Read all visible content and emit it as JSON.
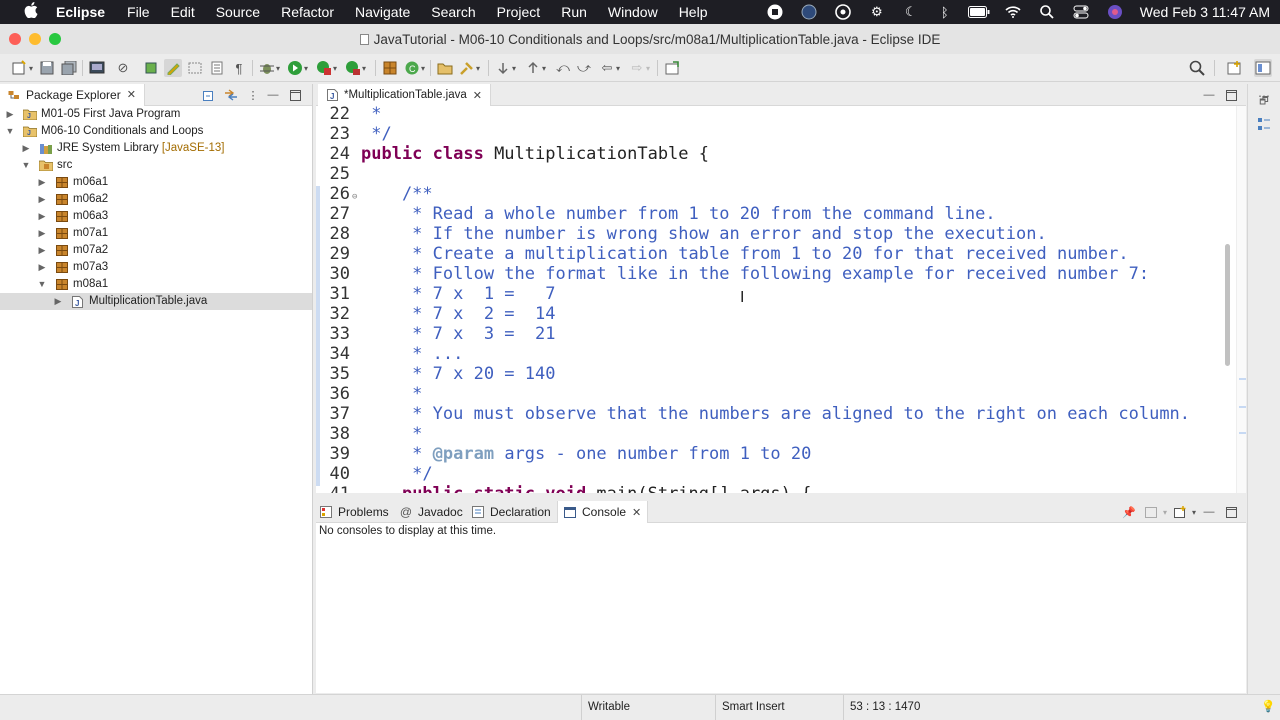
{
  "menubar": {
    "app": "Eclipse",
    "items": [
      "File",
      "Edit",
      "Source",
      "Refactor",
      "Navigate",
      "Search",
      "Project",
      "Run",
      "Window",
      "Help"
    ],
    "clock": "Wed Feb 3  11:47 AM"
  },
  "window": {
    "title": "JavaTutorial - M06-10 Conditionals and Loops/src/m08a1/MultiplicationTable.java - Eclipse IDE"
  },
  "package_explorer": {
    "tab_label": "Package Explorer",
    "tree": [
      {
        "label": "M01-05 First Java Program",
        "decoration": "",
        "expanded": false
      },
      {
        "label": "M06-10 Conditionals and Loops",
        "decoration": "",
        "expanded": true
      },
      {
        "label": "JRE System Library",
        "decoration": "[JavaSE-13]",
        "expanded": false
      },
      {
        "label": "src",
        "decoration": "",
        "expanded": true
      },
      {
        "label": "m06a1",
        "decoration": "",
        "expanded": false
      },
      {
        "label": "m06a2",
        "decoration": "",
        "expanded": false
      },
      {
        "label": "m06a3",
        "decoration": "",
        "expanded": false
      },
      {
        "label": "m07a1",
        "decoration": "",
        "expanded": false
      },
      {
        "label": "m07a2",
        "decoration": "",
        "expanded": false
      },
      {
        "label": "m07a3",
        "decoration": "",
        "expanded": false
      },
      {
        "label": "m08a1",
        "decoration": "",
        "expanded": true
      },
      {
        "label": "MultiplicationTable.java",
        "decoration": "",
        "expanded": false
      }
    ]
  },
  "editor": {
    "tab_label": "*MultiplicationTable.java",
    "lines": [
      {
        "n": "22",
        "kind": "jd",
        "text": " *"
      },
      {
        "n": "23",
        "kind": "jd",
        "text": " */"
      },
      {
        "n": "24",
        "kind": "decl",
        "kw": "public class",
        "text": " MultiplicationTable {"
      },
      {
        "n": "25",
        "kind": "plain",
        "text": ""
      },
      {
        "n": "26",
        "kind": "jd",
        "text": "    /**"
      },
      {
        "n": "27",
        "kind": "jd",
        "text": "     * Read a whole number from 1 to 20 from the command line."
      },
      {
        "n": "28",
        "kind": "jd",
        "text": "     * If the number is wrong show an error and stop the execution."
      },
      {
        "n": "29",
        "kind": "jd",
        "text": "     * Create a multiplication table from 1 to 20 for that received number."
      },
      {
        "n": "30",
        "kind": "jd",
        "text": "     * Follow the format like in the following example for received number 7:"
      },
      {
        "n": "31",
        "kind": "jd",
        "text": "     * 7 x  1 =   7"
      },
      {
        "n": "32",
        "kind": "jd",
        "text": "     * 7 x  2 =  14"
      },
      {
        "n": "33",
        "kind": "jd",
        "text": "     * 7 x  3 =  21"
      },
      {
        "n": "34",
        "kind": "jd",
        "text": "     * ..."
      },
      {
        "n": "35",
        "kind": "jd",
        "text": "     * 7 x 20 = 140"
      },
      {
        "n": "36",
        "kind": "jd",
        "text": "     *"
      },
      {
        "n": "37",
        "kind": "jd",
        "text": "     * You must observe that the numbers are aligned to the right on each column."
      },
      {
        "n": "38",
        "kind": "jd",
        "text": "     *"
      },
      {
        "n": "39",
        "kind": "jdtag",
        "prefix": "     * ",
        "tag": "@param",
        "text": " args - one number from 1 to 20"
      },
      {
        "n": "40",
        "kind": "jd",
        "text": "     */"
      },
      {
        "n": "41",
        "kind": "decl2",
        "kw": "public static void",
        "text": " main(String[] args) {"
      }
    ]
  },
  "bottom_panel": {
    "tabs": [
      "Problems",
      "Javadoc",
      "Declaration",
      "Console"
    ],
    "active_tab": "Console",
    "message": "No consoles to display at this time."
  },
  "statusbar": {
    "mode": "Writable",
    "insert": "Smart Insert",
    "position": "53 : 13 : 1470"
  },
  "colors": {
    "keyword": "#7f0055",
    "javadoc": "#3f5fbf",
    "javadoc_tag": "#7f9fbf",
    "package": "#b5651d"
  }
}
